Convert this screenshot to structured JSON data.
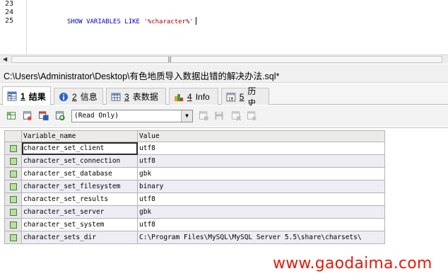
{
  "editor": {
    "line_numbers": [
      "23",
      "24",
      "25"
    ],
    "code": {
      "keyword": "SHOW VARIABLES LIKE",
      "string": "'%character%'"
    }
  },
  "path": {
    "file": "C:\\Users\\Administrator\\Desktop\\有色地质导入数据出错的解决办法.sql*"
  },
  "tabs": [
    {
      "num": "1",
      "label": "结果",
      "icon": "grid-result-icon",
      "active": true
    },
    {
      "num": "2",
      "label": "信息",
      "icon": "info-icon",
      "active": false
    },
    {
      "num": "3",
      "label": "表数据",
      "icon": "table-data-icon",
      "active": false
    },
    {
      "num": "4",
      "label": "Info",
      "icon": "objects-info-icon",
      "active": false
    },
    {
      "num": "5",
      "label": "历史",
      "icon": "history-icon",
      "active": false
    }
  ],
  "toolbar": {
    "mode_select": "(Read Only)"
  },
  "results": {
    "columns": [
      "Variable_name",
      "Value"
    ],
    "rows": [
      [
        "character_set_client",
        "utf8"
      ],
      [
        "character_set_connection",
        "utf8"
      ],
      [
        "character_set_database",
        "gbk"
      ],
      [
        "character_set_filesystem",
        "binary"
      ],
      [
        "character_set_results",
        "utf8"
      ],
      [
        "character_set_server",
        "gbk"
      ],
      [
        "character_set_system",
        "utf8"
      ],
      [
        "character_sets_dir",
        "C:\\Program Files\\MySQL\\MySQL Server 5.5\\share\\charsets\\"
      ]
    ]
  },
  "watermark": "www.gaodaima.com",
  "colors": {
    "keyword": "#0000cc",
    "string": "#b00000",
    "watermark": "#e51a0a",
    "row_alt": "#ededf5"
  }
}
